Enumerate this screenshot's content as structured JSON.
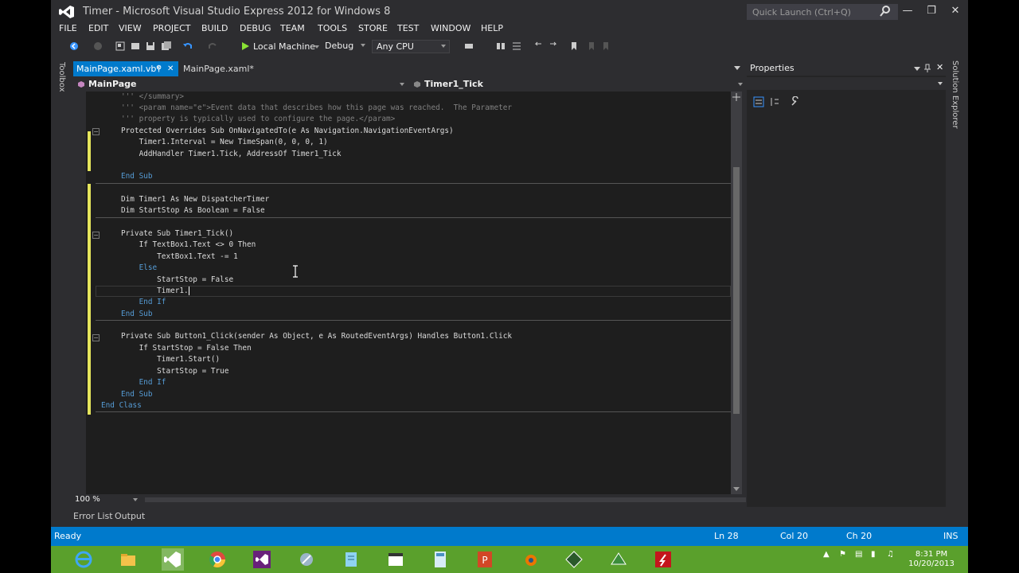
{
  "window": {
    "title": "Timer - Microsoft Visual Studio Express 2012 for Windows 8",
    "quick_launch_placeholder": "Quick Launch (Ctrl+Q)"
  },
  "menu": [
    "FILE",
    "EDIT",
    "VIEW",
    "PROJECT",
    "BUILD",
    "DEBUG",
    "TEAM",
    "TOOLS",
    "STORE",
    "TEST",
    "WINDOW",
    "HELP"
  ],
  "toolbar": {
    "run_target": "Local Machine",
    "configuration": "Debug",
    "platform": "Any CPU"
  },
  "side_strips": {
    "left": "Toolbox",
    "right": "Solution Explorer"
  },
  "tabs": [
    {
      "label": "MainPage.xaml.vb*",
      "active": true
    },
    {
      "label": "MainPage.xaml*",
      "active": false
    }
  ],
  "nav": {
    "left": "MainPage",
    "right": "Timer1_Tick"
  },
  "code": {
    "lines": [
      "''' </summary>",
      "''' <param name=\"e\">Event data that describes how this page was reached.  The Parameter",
      "''' property is typically used to configure the page.</param>",
      "Protected Overrides Sub OnNavigatedTo(e As Navigation.NavigationEventArgs)",
      "    Timer1.Interval = New TimeSpan(0, 0, 0, 1)",
      "    AddHandler Timer1.Tick, AddressOf Timer1_Tick",
      "",
      "End Sub",
      "",
      "Dim Timer1 As New DispatcherTimer",
      "Dim StartStop As Boolean = False",
      "",
      "Private Sub Timer1_Tick()",
      "    If TextBox1.Text <> 0 Then",
      "        TextBox1.Text -= 1",
      "    Else",
      "        StartStop = False",
      "        Timer1.",
      "    End If",
      "End Sub",
      "",
      "Private Sub Button1_Click(sender As Object, e As RoutedEventArgs) Handles Button1.Click",
      "    If StartStop = False Then",
      "        Timer1.Start()",
      "        StartStop = True",
      "    End If",
      "End Sub",
      "End Class"
    ]
  },
  "zoom": "100 %",
  "properties_title": "Properties",
  "bottom_tabs": [
    "Error List",
    "Output"
  ],
  "status": {
    "state": "Ready",
    "line": "Ln 28",
    "col": "Col 20",
    "ch": "Ch 20",
    "mode": "INS"
  },
  "clock": {
    "time": "8:31 PM",
    "date": "10/20/2013"
  },
  "colors": {
    "accent": "#007acc",
    "taskbar": "#5aa02c",
    "keyword": "#569cd6",
    "type": "#4ec9b0",
    "comment": "#57a64a"
  },
  "taskbar_icons": [
    "internet-explorer-icon",
    "file-explorer-icon",
    "visual-studio-icon",
    "chrome-icon",
    "visual-studio-icon",
    "tool-icon",
    "notepad-icon",
    "window-icon",
    "calculator-icon",
    "powerpoint-icon",
    "blender-icon",
    "app-icon",
    "screen-recorder-icon",
    "flash-icon"
  ]
}
